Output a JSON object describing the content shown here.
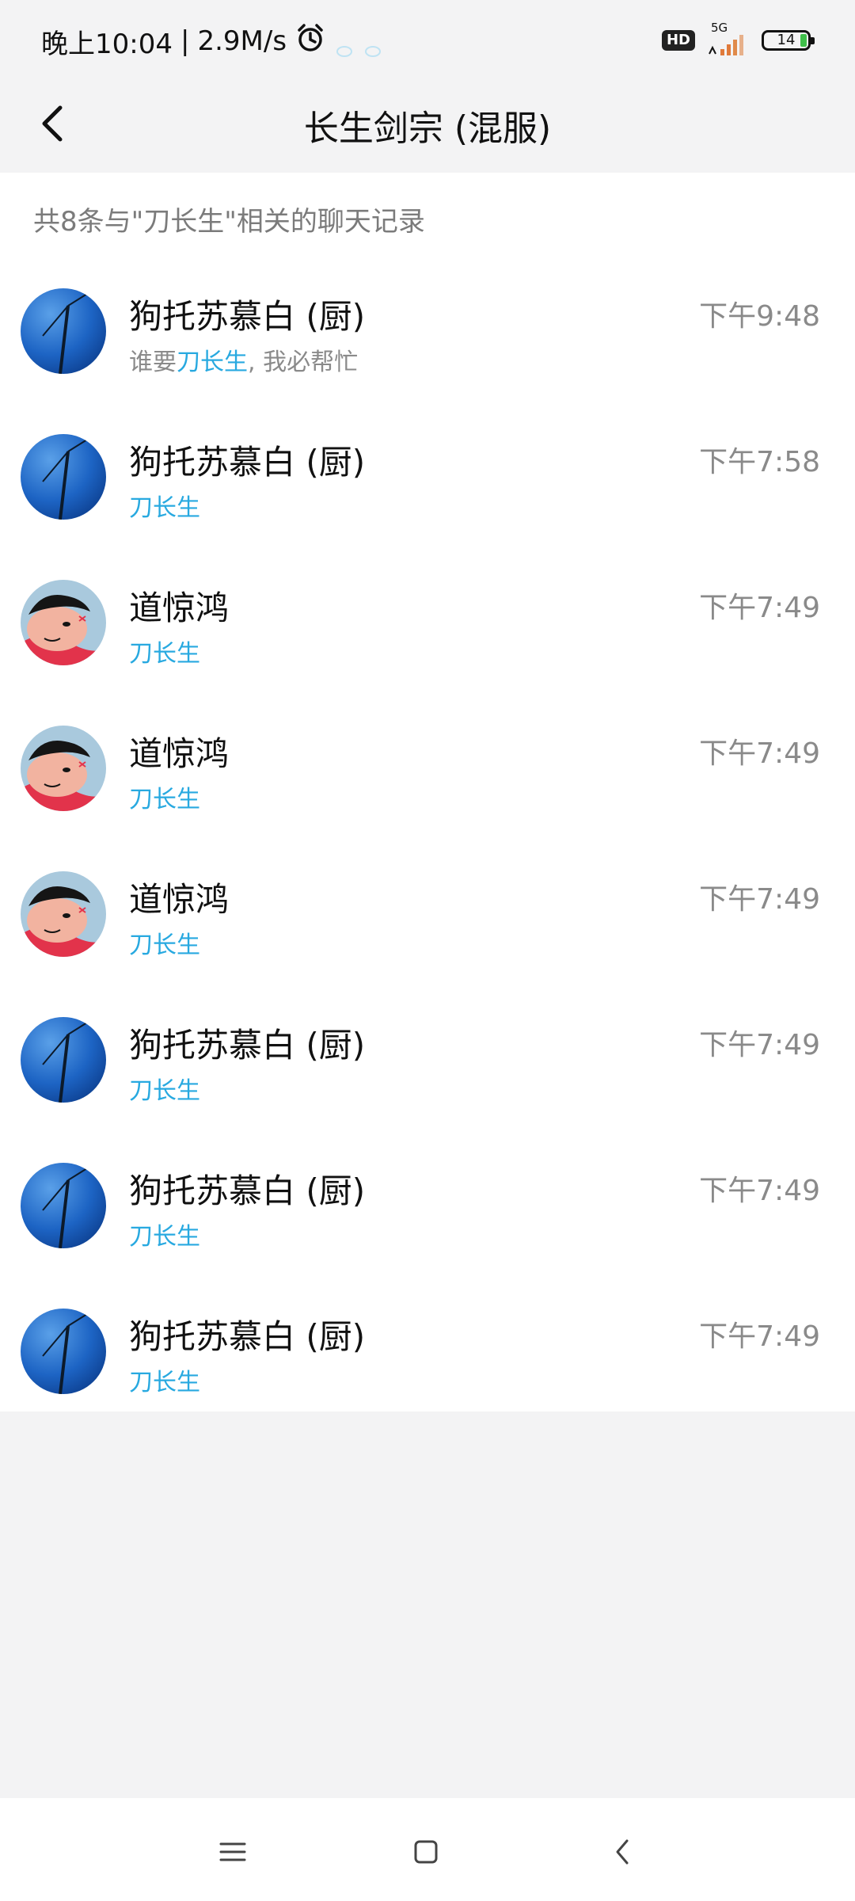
{
  "status": {
    "time": "晚上10:04",
    "separator": "|",
    "speed": "2.9M/s",
    "hd": "HD",
    "network": "5G",
    "battery": "14"
  },
  "header": {
    "title": "长生剑宗 (混服)"
  },
  "summary": "共8条与\"刀长生\"相关的聊天记录",
  "results": [
    {
      "name": "狗托苏慕白 (厨)",
      "time": "下午9:48",
      "prefix": "谁要",
      "keyword": "刀长生",
      "suffix": ", 我必帮忙",
      "avatar": "windmill-avatar"
    },
    {
      "name": "狗托苏慕白 (厨)",
      "time": "下午7:58",
      "prefix": "",
      "keyword": "刀长生",
      "suffix": "",
      "avatar": "windmill-avatar"
    },
    {
      "name": "道惊鸿",
      "time": "下午7:49",
      "prefix": "",
      "keyword": "刀长生",
      "suffix": "",
      "avatar": "cartoon-avatar"
    },
    {
      "name": "道惊鸿",
      "time": "下午7:49",
      "prefix": "",
      "keyword": "刀长生",
      "suffix": "",
      "avatar": "cartoon-avatar"
    },
    {
      "name": "道惊鸿",
      "time": "下午7:49",
      "prefix": "",
      "keyword": "刀长生",
      "suffix": "",
      "avatar": "cartoon-avatar"
    },
    {
      "name": "狗托苏慕白 (厨)",
      "time": "下午7:49",
      "prefix": "",
      "keyword": "刀长生",
      "suffix": "",
      "avatar": "windmill-avatar"
    },
    {
      "name": "狗托苏慕白 (厨)",
      "time": "下午7:49",
      "prefix": "",
      "keyword": "刀长生",
      "suffix": "",
      "avatar": "windmill-avatar"
    },
    {
      "name": "狗托苏慕白 (厨)",
      "time": "下午7:49",
      "prefix": "",
      "keyword": "刀长生",
      "suffix": "",
      "avatar": "windmill-avatar"
    }
  ],
  "colors": {
    "highlight": "#28a9e0",
    "background": "#f3f3f4"
  },
  "icons": {
    "back": "chevron-left-icon",
    "nav_menu": "menu-icon",
    "nav_home": "home-square-icon",
    "nav_back": "back-triangle-icon"
  }
}
